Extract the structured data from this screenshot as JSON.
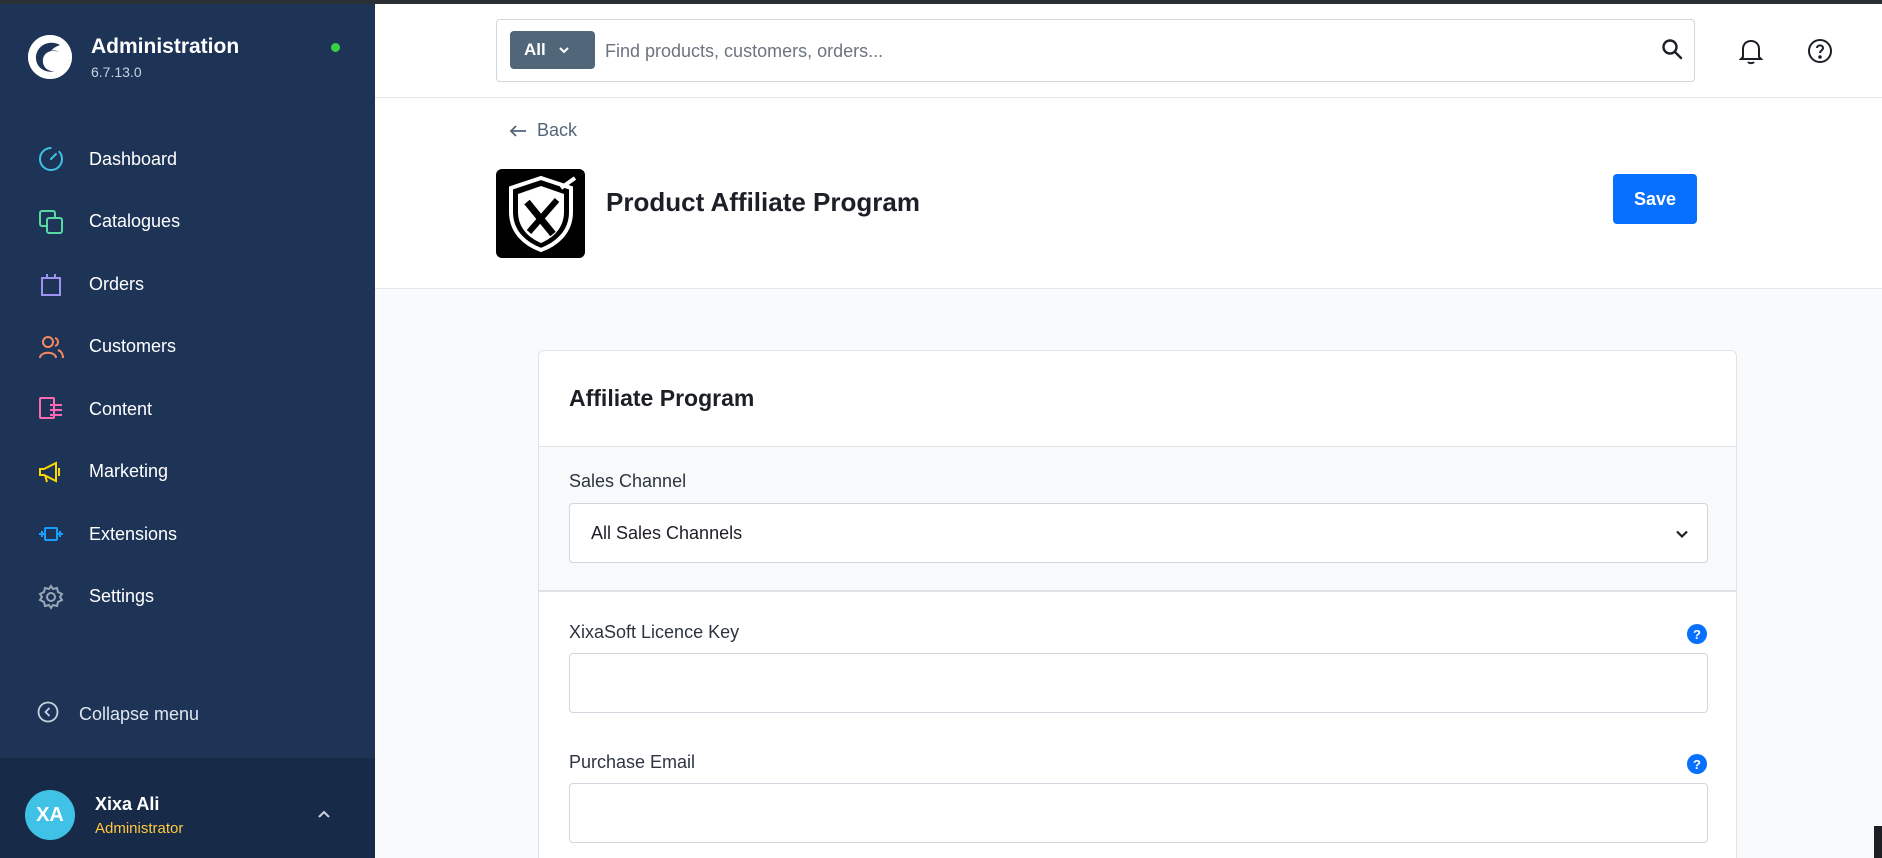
{
  "sidebar": {
    "brand_title": "Administration",
    "brand_version": "6.7.13.0",
    "items": [
      {
        "label": "Dashboard",
        "icon": "dashboard-icon",
        "color": "#3fc2e6"
      },
      {
        "label": "Catalogues",
        "icon": "catalogues-icon",
        "color": "#57d9a3"
      },
      {
        "label": "Orders",
        "icon": "orders-icon",
        "color": "#a092f0"
      },
      {
        "label": "Customers",
        "icon": "customers-icon",
        "color": "#f88962"
      },
      {
        "label": "Content",
        "icon": "content-icon",
        "color": "#ff68b4"
      },
      {
        "label": "Marketing",
        "icon": "marketing-icon",
        "color": "#ffd700"
      },
      {
        "label": "Extensions",
        "icon": "extensions-icon",
        "color": "#189eff"
      },
      {
        "label": "Settings",
        "icon": "settings-icon",
        "color": "#9aa8b5"
      }
    ],
    "collapse_label": "Collapse menu",
    "user": {
      "initials": "XA",
      "name": "Xixa Ali",
      "role": "Administrator"
    }
  },
  "header": {
    "search_type": "All",
    "search_placeholder": "Find products, customers, orders..."
  },
  "page": {
    "back_label": "Back",
    "title": "Product Affiliate Program",
    "save_label": "Save"
  },
  "card": {
    "title": "Affiliate Program",
    "sales_channel_label": "Sales Channel",
    "sales_channel_value": "All Sales Channels",
    "licence_key_label": "XixaSoft Licence Key",
    "licence_key_value": "",
    "purchase_email_label": "Purchase Email",
    "purchase_email_value": "",
    "help_glyph": "?"
  },
  "colors": {
    "sidebar_bg": "#1e3457",
    "accent": "#0870ff",
    "online": "#37d046"
  }
}
